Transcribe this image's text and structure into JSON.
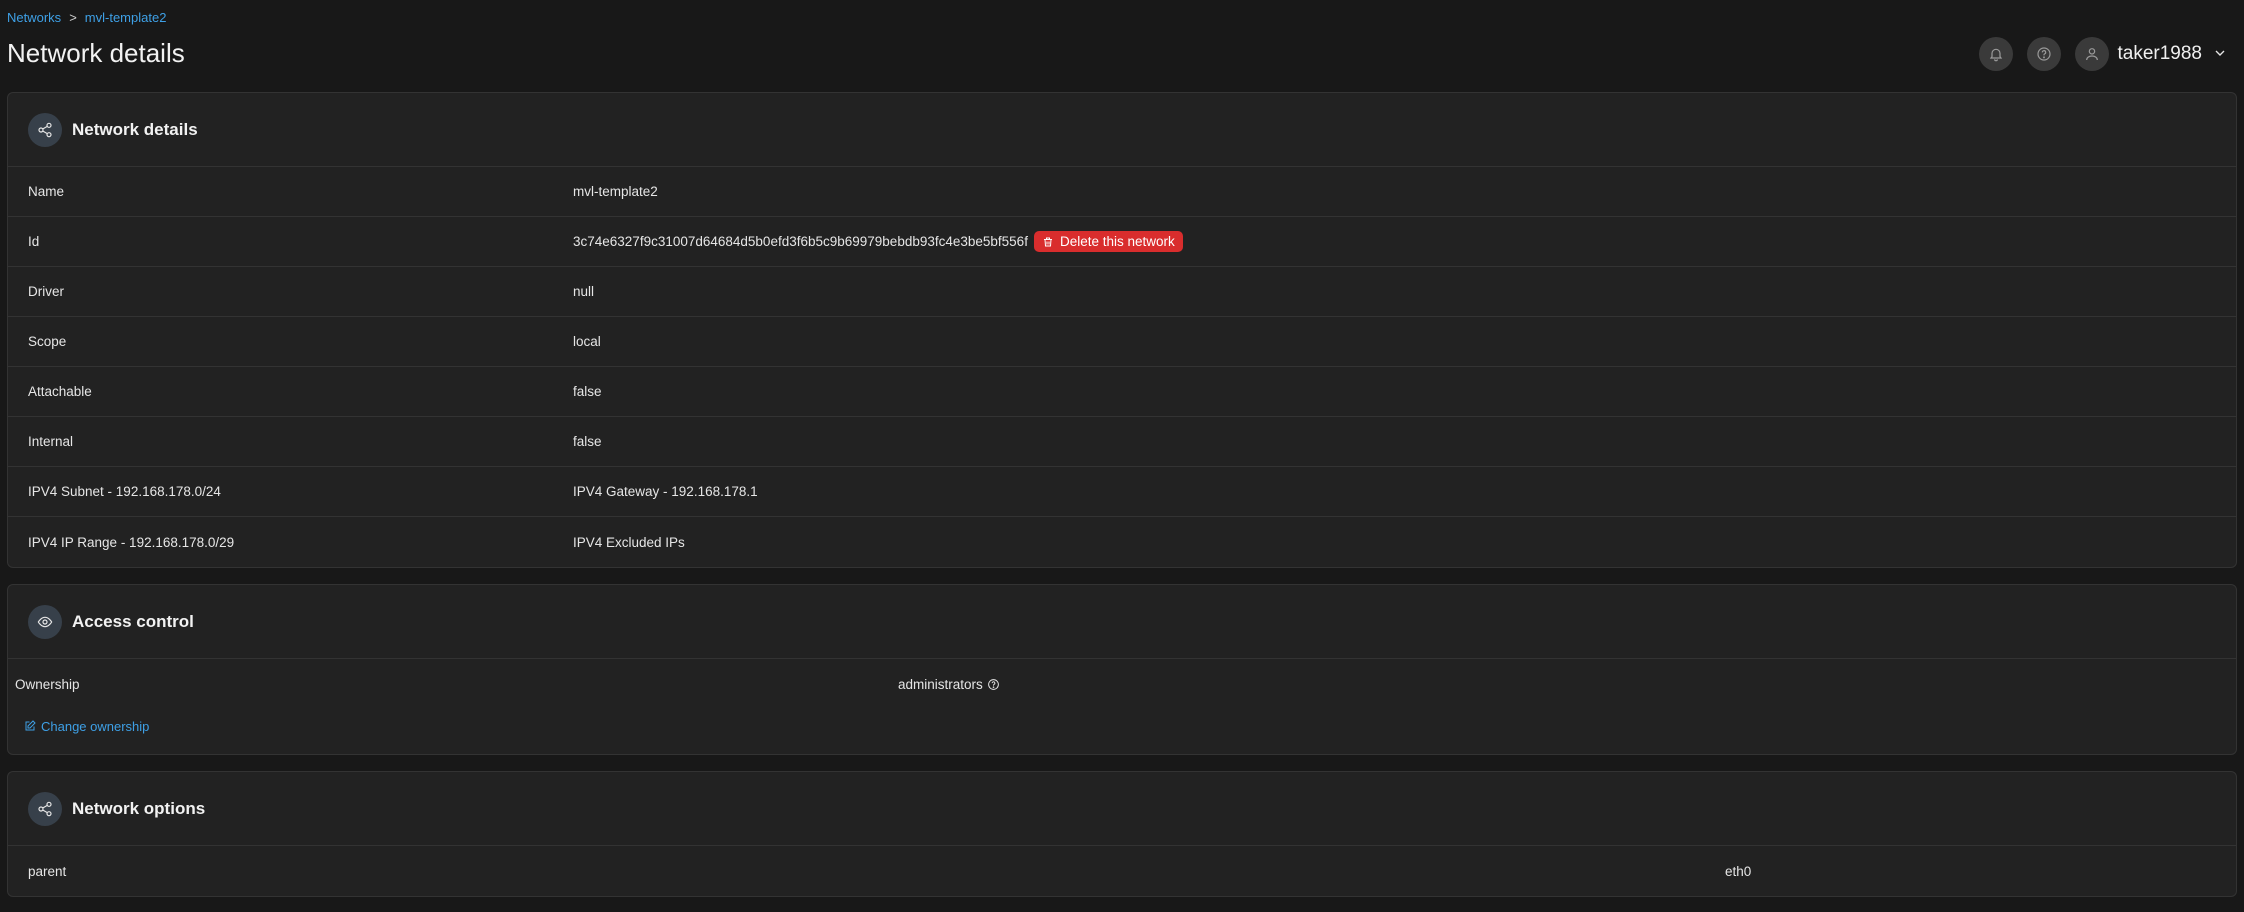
{
  "breadcrumb": {
    "parent": "Networks",
    "separator": ">",
    "current": "mvl-template2"
  },
  "page_title": "Network details",
  "header": {
    "user_name": "taker1988"
  },
  "network_details": {
    "title": "Network details",
    "rows": [
      {
        "key": "Name",
        "value": "mvl-template2"
      },
      {
        "key": "Id",
        "value": "3c74e6327f9c31007d64684d5b0efd3f6b5c9b69979bebdb93fc4e3be5bf556f"
      },
      {
        "key": "Driver",
        "value": "null"
      },
      {
        "key": "Scope",
        "value": "local"
      },
      {
        "key": "Attachable",
        "value": "false"
      },
      {
        "key": "Internal",
        "value": "false"
      },
      {
        "key": "IPV4 Subnet - 192.168.178.0/24",
        "value": "IPV4 Gateway - 192.168.178.1"
      },
      {
        "key": "IPV4 IP Range - 192.168.178.0/29",
        "value": "IPV4 Excluded IPs"
      }
    ],
    "delete_label": "Delete this network"
  },
  "access_control": {
    "title": "Access control",
    "ownership_label": "Ownership",
    "ownership_value": "administrators",
    "change_label": "Change ownership"
  },
  "network_options": {
    "title": "Network options",
    "rows": [
      {
        "key": "parent",
        "value": "eth0"
      }
    ]
  },
  "colors": {
    "background": "#181818",
    "panel": "#222222",
    "accent_link": "#3ea0e6",
    "danger": "#d92d2d"
  }
}
